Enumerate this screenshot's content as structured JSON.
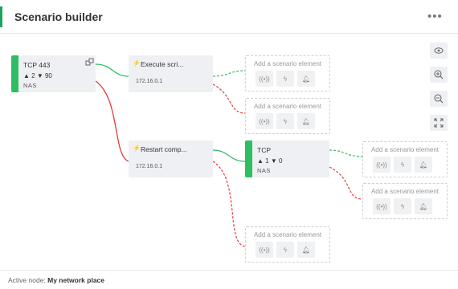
{
  "header": {
    "title": "Scenario builder"
  },
  "device_nodes": [
    {
      "name": "TCP 443",
      "stats": "▲ 2 ▼ 90",
      "type": "NAS"
    },
    {
      "name": "TCP",
      "stats": "▲ 1 ▼ 0",
      "type": "NAS"
    }
  ],
  "action_nodes": [
    {
      "name": "Execute scri...",
      "ip": "172.16.0.1",
      "status": "success"
    },
    {
      "name": "Restart comp...",
      "ip": "172.16.0.1",
      "status": "failure"
    }
  ],
  "add_element": {
    "label": "Add a scenario element",
    "icons": [
      "signal-icon",
      "lightning-icon",
      "bell-icon"
    ]
  },
  "toolbar": {
    "icons": [
      "eye-icon",
      "zoom-in-icon",
      "zoom-out-icon",
      "fit-screen-icon"
    ]
  },
  "footer": {
    "label": "Active node:",
    "value": "My network place"
  },
  "colors": {
    "success": "#2fbd62",
    "failure": "#e03a3a",
    "accent": "#1aa260"
  }
}
